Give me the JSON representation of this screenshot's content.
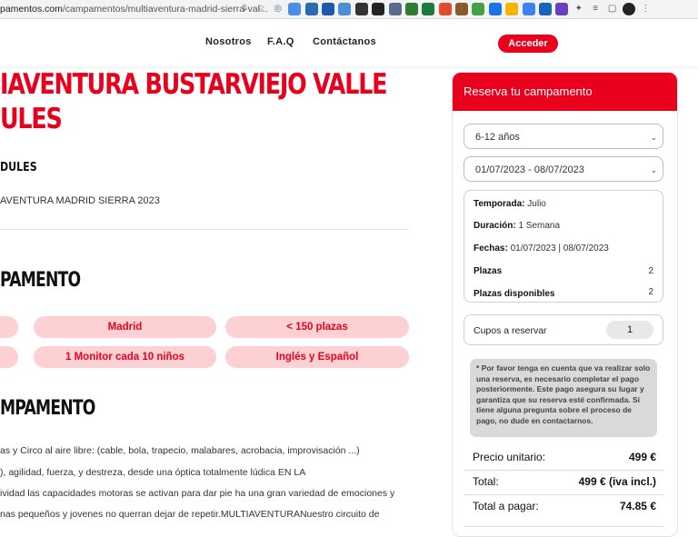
{
  "browser": {
    "url_prefix": "pamentos.com",
    "url_path": "/campamentos/multiaventura-madrid-sierra-val..."
  },
  "nav": {
    "items": [
      "Nosotros",
      "F.A.Q",
      "Contáctanos"
    ],
    "login_label": "Acceder"
  },
  "content": {
    "title_line1": "IAVENTURA BUSTARVIEJO VALLE",
    "title_line2": "ULES",
    "subhead": "DULES",
    "program_line": "AVENTURA MADRID SIERRA 2023",
    "section1_title": "PAMENTO",
    "pills": [
      "Madrid",
      "< 150 plazas",
      "1 Monitor cada 10 niños",
      "Inglés y Español"
    ],
    "section2_title": "MPAMENTO",
    "paragraph_lines": [
      "as y Circo al aire libre: (cable, bola, trapecio, malabares, acrobacia, improvisación ...)",
      "), agilidad, fuerza, y destreza, desde una óptica totalmente lúdica EN LA",
      "ividad las capacidades motoras se activan para dar pie ha una gran variedad de emociones y",
      "nas pequeños y jovenes no querran dejar de repetir.MULTIAVENTURANuestro circuito de"
    ]
  },
  "booking": {
    "header": "Reserva tu campamento",
    "age_select": "6-12 años",
    "date_select": "01/07/2023 - 08/07/2023",
    "temporada_label": "Temporada:",
    "temporada_value": "Julio",
    "duracion_label": "Duración:",
    "duracion_value": "1 Semana",
    "fechas_label": "Fechas:",
    "fechas_value": "01/07/2023 | 08/07/2023",
    "plazas_label": "Plazas",
    "plazas_value": "2",
    "disponibles_label": "Plazas disponibles",
    "disponibles_value": "2",
    "cupos_label": "Cupos a reservar",
    "cupos_value": "1",
    "note": "* Por favor tenga en cuenta que va realizar solo una reserva, es necesario completar el pago posteriormente. Este pago asegura su lugar y garantiza que su reserva esté confirmada. Si tiene alguna pregunta sobre el proceso de pago, no dude en contactarnos.",
    "precio_unitario_label": "Precio unitario:",
    "precio_unitario_value": "499 €",
    "total_label": "Total:",
    "total_value": "499 € (iva incl.)",
    "a_pagar_label": "Total a pagar:",
    "a_pagar_value": "74.85 €"
  },
  "colors": {
    "accent": "#e8001c",
    "pill_bg": "#fdd1d4"
  }
}
